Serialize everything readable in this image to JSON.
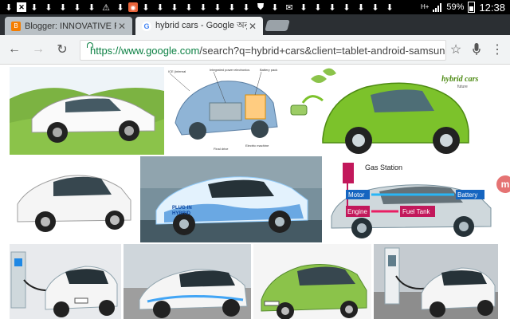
{
  "status_bar": {
    "notification_icons": [
      "download-icon",
      "close-box-icon",
      "download-icon",
      "download-icon",
      "download-icon",
      "download-icon",
      "download-icon",
      "warning-icon",
      "app-icon",
      "download-icon",
      "download-icon",
      "download-icon",
      "download-icon",
      "download-icon",
      "download-icon",
      "download-icon",
      "download-icon",
      "download-icon",
      "download-icon",
      "shield-icon",
      "download-icon",
      "mail-icon",
      "download-icon",
      "download-icon",
      "download-icon",
      "download-icon",
      "download-icon",
      "download-icon",
      "download-icon"
    ],
    "network": "H+",
    "battery": "59%",
    "time": "12:38"
  },
  "tabs": [
    {
      "title": "Blogger: INNOVATIVE PROD",
      "favicon": "blogger",
      "active": false
    },
    {
      "title": "hybrid cars - Google অনুসন্ধ",
      "favicon": "google",
      "active": true
    }
  ],
  "toolbar": {
    "url_host": "https://www.google.com",
    "url_rest": "/search?q=hybrid+cars&client=tablet-android-samsung"
  },
  "images": [
    {
      "name": "toyota-prius-hills",
      "colors": [
        "#7cb342",
        "#ffffff"
      ]
    },
    {
      "name": "hybrid-car-cutaway-diagram",
      "labels": [
        "Integrated power electronics",
        "Battery pack",
        "Final drive",
        "Electric machine"
      ]
    },
    {
      "name": "green-hybrid-car",
      "labels": [
        "hybrid cars",
        "future"
      ]
    },
    {
      "name": "white-prius-studio"
    },
    {
      "name": "plug-in-hybrid-prius",
      "labels": [
        "PLUG-IN HYBRID"
      ]
    },
    {
      "name": "gas-station-diagram",
      "labels": [
        "Gas Station",
        "Motor",
        "Battery",
        "Engine",
        "Fuel Tank"
      ]
    },
    {
      "name": "nissan-leaf-charging"
    },
    {
      "name": "prius-plug-in-charging"
    },
    {
      "name": "green-honda-jazz-hybrid"
    },
    {
      "name": "nissan-leaf-charger"
    }
  ]
}
